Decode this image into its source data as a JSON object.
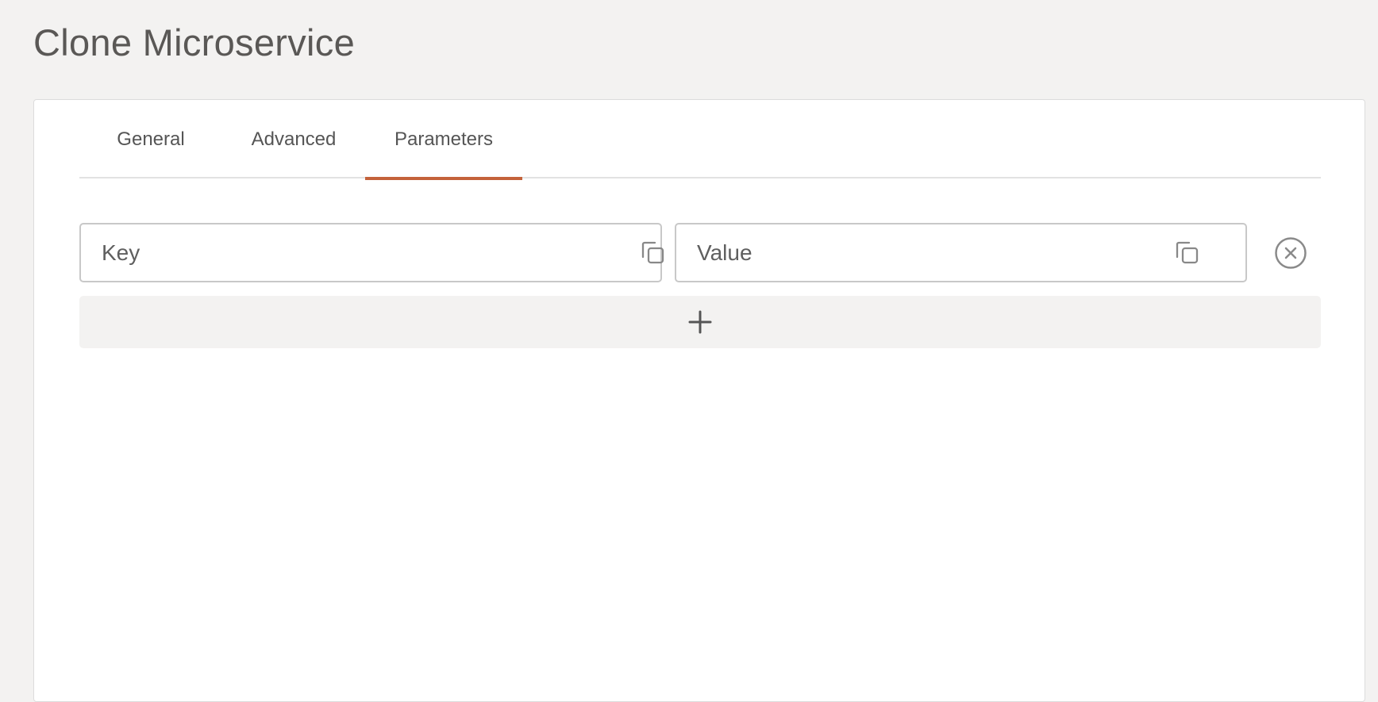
{
  "page": {
    "title": "Clone Microservice"
  },
  "tabs": [
    {
      "label": "General",
      "active": false
    },
    {
      "label": "Advanced",
      "active": false
    },
    {
      "label": "Parameters",
      "active": true
    }
  ],
  "parameters": {
    "key_placeholder": "Key",
    "key_value": "",
    "value_placeholder": "Value",
    "value_value": ""
  },
  "icons": {
    "copy": "copy-icon",
    "remove": "close-circle-icon",
    "add": "plus-icon"
  },
  "colors": {
    "accent": "#c4623a",
    "background": "#f3f2f1",
    "card": "#ffffff",
    "text": "#555555"
  }
}
